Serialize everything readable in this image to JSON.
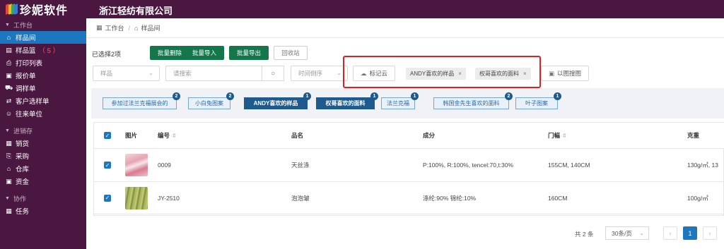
{
  "brand": {
    "logo_text": "珍妮软件",
    "company": "浙江轻纺有限公司",
    "logo_colors": [
      "#e8453c",
      "#f7b52c",
      "#35a853",
      "#3a7bd5"
    ]
  },
  "sidebar": {
    "sections": [
      {
        "title": "工作台",
        "items": [
          {
            "label": "样品间",
            "icon": "home-icon",
            "glyph": "⌂",
            "active": true
          },
          {
            "label": "样品篮",
            "icon": "basket-icon",
            "glyph": "▤",
            "badge": "（ 5 ）"
          },
          {
            "label": "打印列表",
            "icon": "printer-icon",
            "glyph": "⎙"
          },
          {
            "label": "报价单",
            "icon": "quote-icon",
            "glyph": "▣"
          },
          {
            "label": "调样单",
            "icon": "cart-icon",
            "glyph": "⛟"
          },
          {
            "label": "客户选样单",
            "icon": "swap-icon",
            "glyph": "⇄"
          },
          {
            "label": "往来单位",
            "icon": "contacts-icon",
            "glyph": "☺"
          }
        ]
      },
      {
        "title": "进销存",
        "items": [
          {
            "label": "销货",
            "icon": "sales-icon",
            "glyph": "▦"
          },
          {
            "label": "采购",
            "icon": "purchase-icon",
            "glyph": "⎘"
          },
          {
            "label": "仓库",
            "icon": "warehouse-icon",
            "glyph": "⌂"
          },
          {
            "label": "资金",
            "icon": "money-icon",
            "glyph": "▣"
          }
        ]
      },
      {
        "title": "协作",
        "items": [
          {
            "label": "任务",
            "icon": "task-icon",
            "glyph": "▦"
          }
        ]
      }
    ]
  },
  "breadcrumb": {
    "home": "工作台",
    "separator": "/",
    "current": "样品间"
  },
  "toolbar": {
    "selected_note": "已选择2项",
    "batch_delete": "批量删除",
    "batch_import": "批量导入",
    "batch_export": "批量导出",
    "recycle_bin": "回收站"
  },
  "filters": {
    "type_select": "样品",
    "search_placeholder": "请搜索",
    "sort_select": "时间倒序",
    "tag_cloud": "标记云",
    "active_tags": [
      "ANDY喜欢的样品",
      "权哥喜欢的面料"
    ],
    "image_search": "以图搜图"
  },
  "tags": [
    {
      "label": "参加过法兰克福展会的",
      "count": "2",
      "on": false
    },
    {
      "label": "小白兔图案",
      "count": "2",
      "on": false
    },
    {
      "label": "ANDY喜欢的样品",
      "count": "1",
      "on": true
    },
    {
      "label": "权哥喜欢的面料",
      "count": "1",
      "on": true
    },
    {
      "label": "法兰克福",
      "count": "1",
      "on": false
    },
    {
      "label": "韩国金先生喜欢的面料",
      "count": "2",
      "on": false
    },
    {
      "label": "叶子图案",
      "count": "1",
      "on": false
    }
  ],
  "table": {
    "headers": {
      "image": "图片",
      "code": "编号",
      "name": "品名",
      "composition": "成分",
      "width": "门幅",
      "weight": "克重"
    },
    "rows": [
      {
        "code": "0009",
        "name": "天丝涤",
        "composition": "P:100%, R:100%, tencel:70,t:30%",
        "width": "155CM, 140CM",
        "weight": "130g/㎡, 13",
        "thumb": "pink-fabric"
      },
      {
        "code": "JY-2510",
        "name": "泡泡皱",
        "composition": "涤纶:90% 锦纶:10%",
        "width": "160CM",
        "weight": "100g/㎡",
        "thumb": "green-fabric"
      }
    ]
  },
  "pagination": {
    "total": "共 2 条",
    "page_size": "30条/页",
    "prev": "‹",
    "current_page": "1",
    "next": "›"
  }
}
